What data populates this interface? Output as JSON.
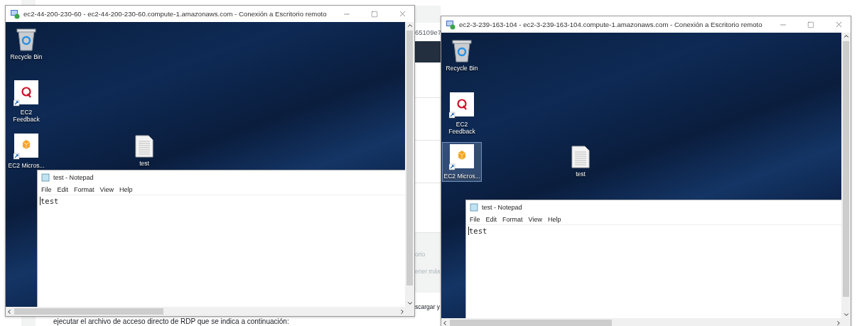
{
  "background_page": {
    "fragments": [
      {
        "kind": "id",
        "text": "65109e7"
      },
      {
        "kind": "muted",
        "text": "orio"
      },
      {
        "kind": "muted",
        "text": "ener más"
      },
      {
        "kind": "body",
        "text": "scargar y"
      }
    ],
    "body_text": "ejecutar el archivo de acceso directo de RDP que se indica a continuación:"
  },
  "windows": [
    {
      "title": "ec2-44-200-230-60 - ec2-44-200-230-60.compute-1.amazonaws.com - Conexión a Escritorio remoto",
      "desktop_icons": [
        {
          "label": "Recycle Bin",
          "kind": "recycle-bin",
          "selected": false
        },
        {
          "label": "EC2 Feedback",
          "kind": "feedback-app",
          "selected": false
        },
        {
          "label": "EC2 Micros...",
          "kind": "box-app",
          "selected": false
        },
        {
          "label": "test",
          "kind": "text-file",
          "selected": false
        }
      ],
      "notepad": {
        "title": "test - Notepad",
        "menu": [
          "File",
          "Edit",
          "Format",
          "View",
          "Help"
        ],
        "content": "test"
      }
    },
    {
      "title": "ec2-3-239-163-104 - ec2-3-239-163-104.compute-1.amazonaws.com - Conexión a Escritorio remoto",
      "desktop_icons": [
        {
          "label": "Recycle Bin",
          "kind": "recycle-bin",
          "selected": false
        },
        {
          "label": "EC2 Feedback",
          "kind": "feedback-app",
          "selected": false
        },
        {
          "label": "EC2 Micros...",
          "kind": "box-app",
          "selected": true
        },
        {
          "label": "test",
          "kind": "text-file",
          "selected": false
        }
      ],
      "notepad": {
        "title": "test - Notepad",
        "menu": [
          "File",
          "Edit",
          "Format",
          "View",
          "Help"
        ],
        "content": "test"
      }
    }
  ]
}
